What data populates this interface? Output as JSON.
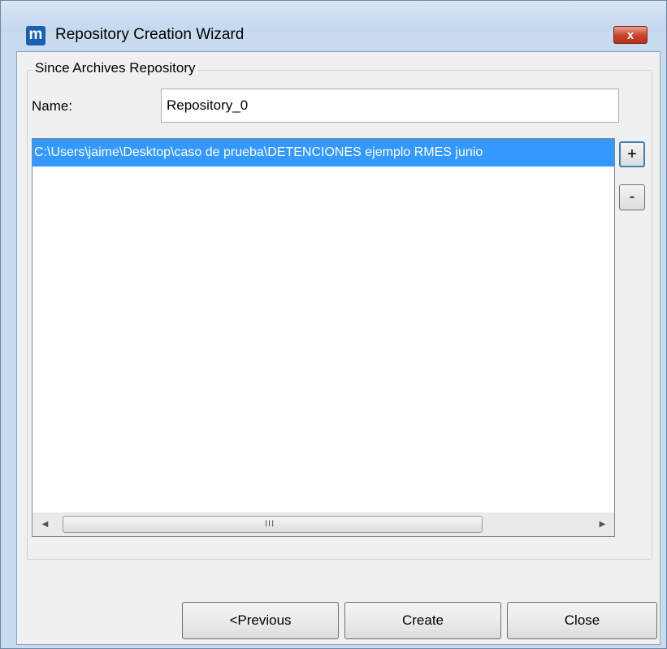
{
  "window": {
    "app_icon_glyph": "m",
    "title": "Repository Creation Wizard",
    "close_glyph": "x"
  },
  "group": {
    "label": "Since Archives Repository"
  },
  "name_field": {
    "label": "Name:",
    "value": "Repository_0"
  },
  "paths_list": {
    "items": [
      "C:\\Users\\jaime\\Desktop\\caso de prueba\\DETENCIONES ejemplo RMES junio"
    ],
    "scroll": {
      "left_arrow": "◀",
      "right_arrow": "▶",
      "grip": "III"
    }
  },
  "side_buttons": {
    "add_label": "+",
    "remove_label": "-"
  },
  "footer": {
    "previous_label": "<Previous",
    "create_label": "Create",
    "close_label": "Close"
  },
  "colors": {
    "selection": "#3399ff",
    "title_bar": "#c9dbef",
    "close_button": "#c9422b"
  }
}
